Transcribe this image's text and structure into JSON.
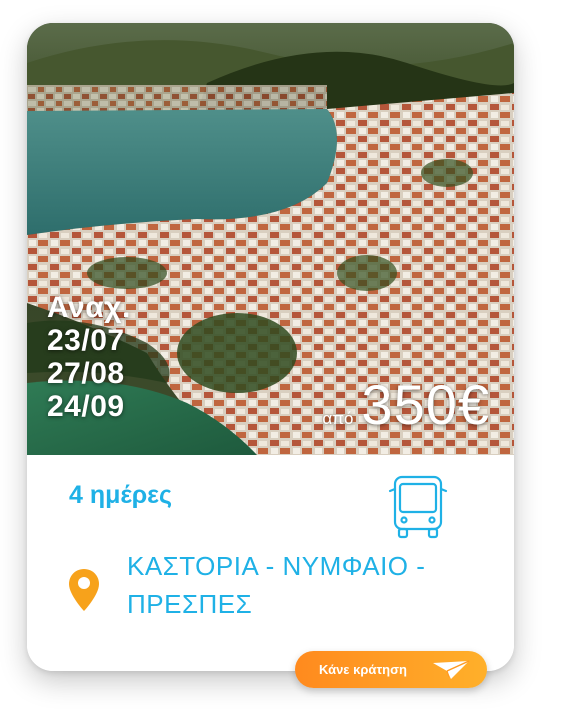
{
  "card": {
    "image_alt": "Aerial view of the lakeside town of Kastoria",
    "dates_label": "Αναχ.",
    "dates": [
      "23/07",
      "27/08",
      "24/09"
    ],
    "price_prefix": "από",
    "price": "350€",
    "duration": "4 ημέρες",
    "route": "ΚΑΣΤΟΡΙΑ - ΝΥΜΦΑΙΟ - ΠΡΕΣΠΕΣ",
    "transport_icon": "bus-icon",
    "location_icon": "location-pin-icon",
    "book_button_label": "Κάνε κράτηση",
    "book_button_icon": "paper-plane-icon"
  },
  "colors": {
    "accent": "#1fb1e6",
    "button_start": "#ff8a1e",
    "button_end": "#ffb02a",
    "pin": "#f7a21b"
  }
}
